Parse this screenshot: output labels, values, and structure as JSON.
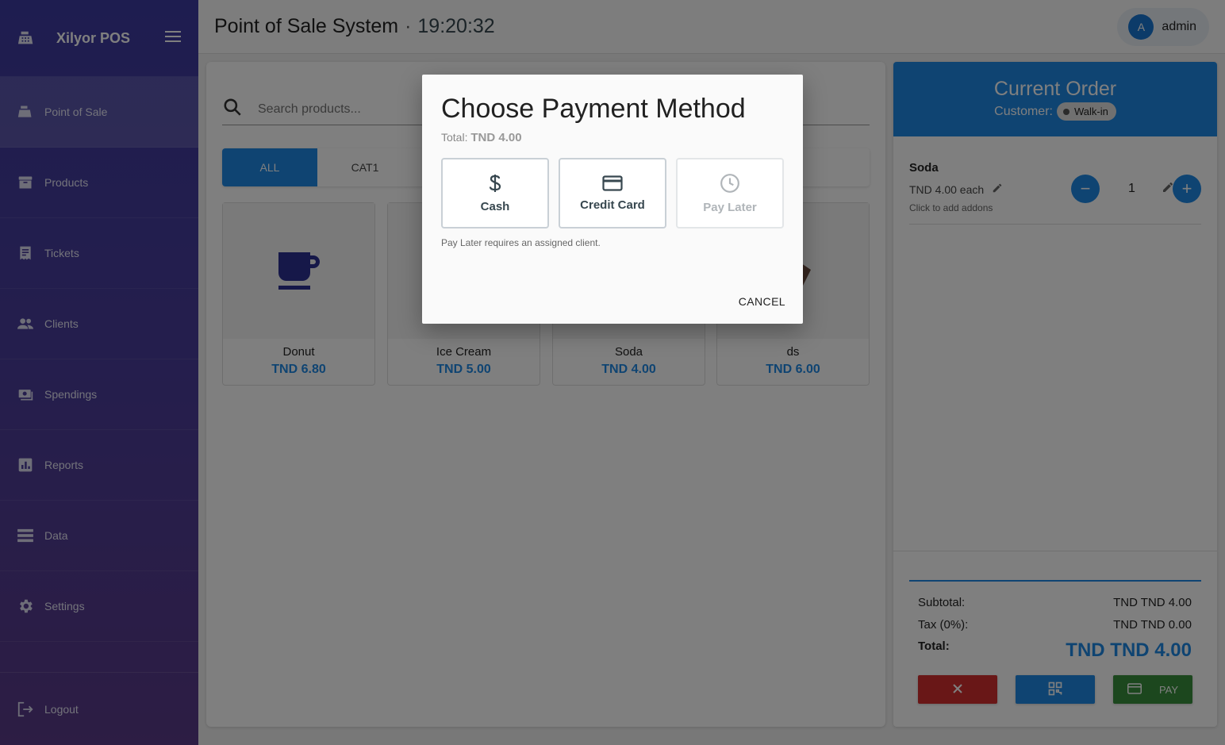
{
  "sidebar": {
    "brand": "Xilyor POS",
    "items": [
      {
        "label": "Point of Sale",
        "icon": "register-icon"
      },
      {
        "label": "Products",
        "icon": "archive-icon"
      },
      {
        "label": "Tickets",
        "icon": "receipt-icon"
      },
      {
        "label": "Clients",
        "icon": "people-icon"
      },
      {
        "label": "Spendings",
        "icon": "money-icon"
      },
      {
        "label": "Reports",
        "icon": "chart-icon"
      },
      {
        "label": "Data",
        "icon": "storage-icon"
      },
      {
        "label": "Settings",
        "icon": "gear-icon"
      }
    ],
    "logout": "Logout"
  },
  "header": {
    "title": "Point of Sale System",
    "separator": "·",
    "time": "19:20:32",
    "user_initial": "A",
    "user_name": "admin"
  },
  "products": {
    "search_placeholder": "Search products...",
    "categories": [
      "ALL",
      "CAT1"
    ],
    "items": [
      {
        "name": "Donut",
        "price": "TND 6.80"
      },
      {
        "name": "Ice Cream",
        "price": "TND 5.00"
      },
      {
        "name": "Soda",
        "price": "TND 4.00"
      },
      {
        "name": "ds",
        "price": "TND 6.00"
      }
    ]
  },
  "order": {
    "title": "Current Order",
    "customer_label": "Customer:",
    "customer": "Walk-in",
    "item": {
      "name": "Soda",
      "each": "TND 4.00 each",
      "addons": "Click to add addons",
      "qty": "1"
    },
    "subtotal_label": "Subtotal:",
    "subtotal": "TND TND 4.00",
    "tax_label": "Tax (0%):",
    "tax": "TND TND 0.00",
    "total_label": "Total:",
    "total": "TND TND 4.00",
    "pay_label": "PAY",
    "colors": {
      "accent": "#1e88e5",
      "cancel": "#d32f2f",
      "pay": "#388e3c"
    }
  },
  "dialog": {
    "title": "Choose Payment Method",
    "total_label": "Total:",
    "total": "TND 4.00",
    "methods": [
      "Cash",
      "Credit Card",
      "Pay Later"
    ],
    "note": "Pay Later requires an assigned client.",
    "cancel": "CANCEL"
  }
}
